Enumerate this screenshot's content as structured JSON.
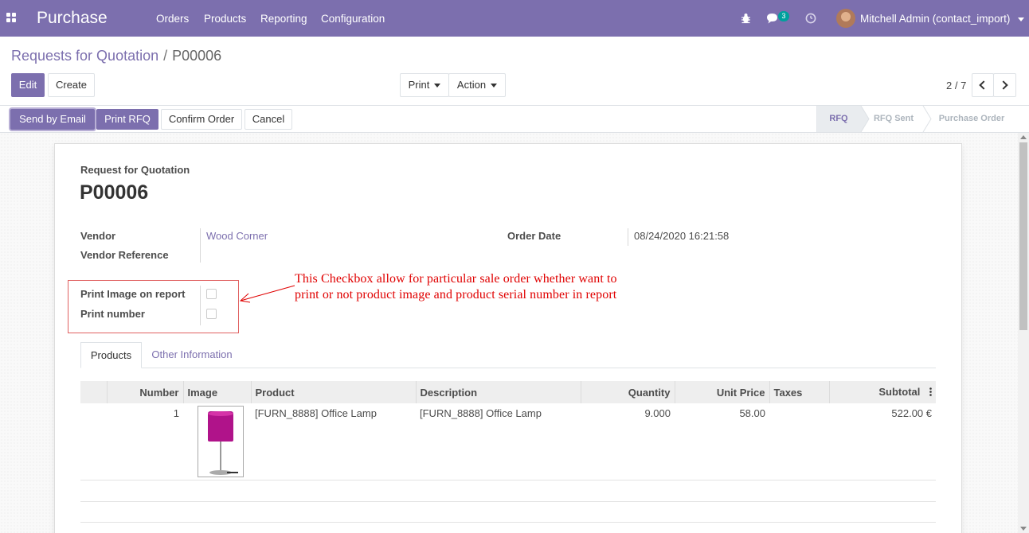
{
  "navbar": {
    "app_title": "Purchase",
    "menu": [
      "Orders",
      "Products",
      "Reporting",
      "Configuration"
    ],
    "chat_count": "3",
    "user_name": "Mitchell Admin (contact_import)",
    "icons": [
      "apps-icon",
      "bug-icon",
      "chat-icon",
      "clock-icon"
    ]
  },
  "breadcrumb": {
    "parent": "Requests for Quotation",
    "separator": "/",
    "current": "P00006"
  },
  "control": {
    "edit": "Edit",
    "create": "Create",
    "print": "Print",
    "action": "Action",
    "pager": "2 / 7"
  },
  "status_buttons": {
    "send_email": "Send by Email",
    "print_rfq": "Print RFQ",
    "confirm": "Confirm Order",
    "cancel": "Cancel"
  },
  "stages": [
    "RFQ",
    "RFQ Sent",
    "Purchase Order"
  ],
  "active_stage": "RFQ",
  "form": {
    "title_label": "Request for Quotation",
    "name": "P00006",
    "vendor_label": "Vendor",
    "vendor_value": "Wood Corner",
    "vendor_ref_label": "Vendor Reference",
    "order_date_label": "Order Date",
    "order_date_value": "08/24/2020 16:21:58",
    "print_image_label": "Print Image on report",
    "print_number_label": "Print number",
    "print_image_checked": false,
    "print_number_checked": false
  },
  "annotation": {
    "line1": "This Checkbox allow for particular sale order whether want to",
    "line2": "print or not product image and product serial number in report"
  },
  "tabs": [
    "Products",
    "Other Information"
  ],
  "lines_table": {
    "headers": [
      "Number",
      "Image",
      "Product",
      "Description",
      "Quantity",
      "Unit Price",
      "Taxes",
      "Subtotal"
    ],
    "rows": [
      {
        "number": "1",
        "image": "office-lamp",
        "product": "[FURN_8888] Office Lamp",
        "description": "[FURN_8888] Office Lamp",
        "quantity": "9.000",
        "unit_price": "58.00",
        "taxes": "",
        "subtotal": "522.00 €"
      }
    ]
  },
  "colors": {
    "brand": "#7c6fae",
    "annotation": "#e00000"
  }
}
